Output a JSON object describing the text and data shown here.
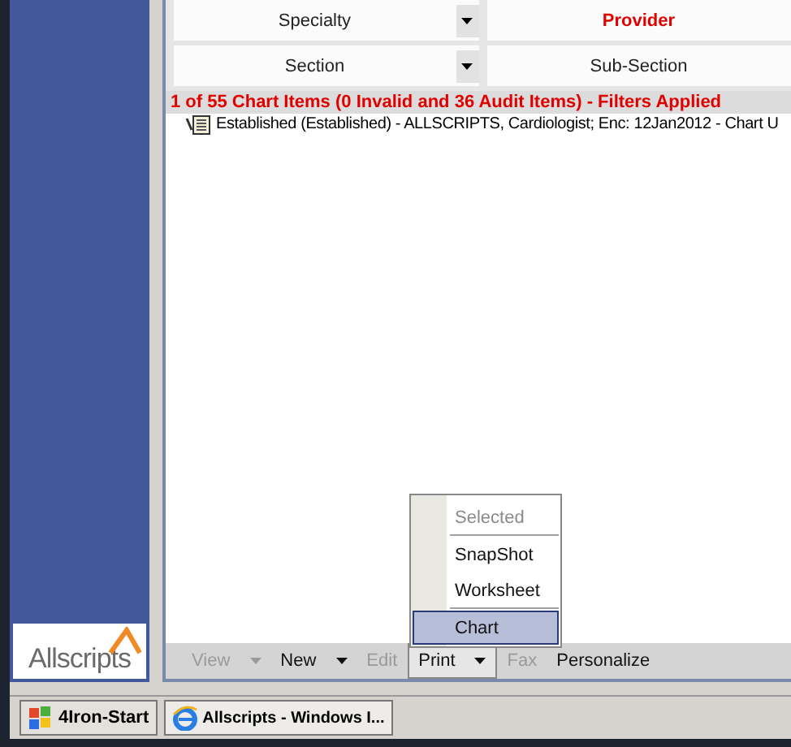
{
  "filters": [
    {
      "label": "Specialty",
      "kind": "dropdown",
      "active": false
    },
    {
      "label": "Provider",
      "kind": "plain",
      "active": true
    },
    {
      "label": "Section",
      "kind": "dropdown",
      "active": false
    },
    {
      "label": "Sub-Section",
      "kind": "plain",
      "active": false
    }
  ],
  "status": "1 of 55 Chart Items (0 Invalid and 36 Audit Items) - Filters Applied",
  "items": [
    {
      "text": "Established (Established) - ALLSCRIPTS, Cardiologist; Enc: 12Jan2012 - Chart U"
    }
  ],
  "logo": "Allscripts",
  "toolbar": [
    {
      "label": "View",
      "disabled": true,
      "dropdown": true,
      "pressed": false
    },
    {
      "label": "New",
      "disabled": false,
      "dropdown": true,
      "pressed": false
    },
    {
      "label": "Edit",
      "disabled": true,
      "dropdown": false,
      "pressed": false
    },
    {
      "label": "Print",
      "disabled": false,
      "dropdown": true,
      "pressed": true
    },
    {
      "label": "Fax",
      "disabled": true,
      "dropdown": false,
      "pressed": false
    },
    {
      "label": "Personalize",
      "disabled": false,
      "dropdown": false,
      "pressed": false
    }
  ],
  "menu": [
    {
      "label": "Selected",
      "disabled": true,
      "selected": false,
      "separator_after": true
    },
    {
      "label": "SnapShot",
      "disabled": false,
      "selected": false,
      "separator_after": false
    },
    {
      "label": "Worksheet",
      "disabled": false,
      "selected": false,
      "separator_after": true
    },
    {
      "label": "Chart",
      "disabled": false,
      "selected": true,
      "separator_after": false
    }
  ],
  "taskbar": [
    {
      "label": "4Iron-Start",
      "kind": "start"
    },
    {
      "label": "Allscripts - Windows I...",
      "kind": "browser"
    }
  ]
}
